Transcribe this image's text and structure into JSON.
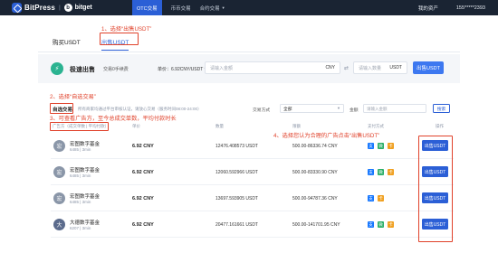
{
  "nav": {
    "brand": "BitPress",
    "partner": "bitget",
    "links": [
      {
        "label": "OTC交易",
        "active": true
      },
      {
        "label": "币币交易",
        "active": false
      },
      {
        "label": "合约交易",
        "active": false
      }
    ],
    "my_assets": "我的资产",
    "user": "155*****2393"
  },
  "tabs": {
    "buy": "购买USDT",
    "sell": "出售USDT"
  },
  "annotations": {
    "step1": "1、选择“出售USDT”",
    "step2": "2、选择“自选交易”",
    "step3": "3、可查看广告方，至今总成交单数，平均付款时长",
    "step4": "4、选择您认为合理的广告点击“出售USDT”"
  },
  "quick": {
    "title": "极速出售",
    "subtitle": "交易0手续费",
    "price_label": "单价：",
    "price_value": "6.92CNY/USDT",
    "price_caret": "▾",
    "amount_placeholder": "请输入金额",
    "amount_unit": "CNY",
    "swap": "⇄",
    "qty_placeholder": "请输入数量",
    "qty_unit": "USDT",
    "button": "出售USDT"
  },
  "filter": {
    "tab": "自选交易",
    "note": "所有商家均通过平台审核认证，请放心交易（服务时间08:00-24:00）",
    "payment_label": "交易方式",
    "payment_value": "全部",
    "amount_label": "金额",
    "amount_placeholder": "请输入金额",
    "search": "搜索"
  },
  "table": {
    "headers": {
      "advertiser": "广告方（成交单数 | 平均付款）",
      "price": "单价",
      "qty": "数量",
      "limit": "限额",
      "payment": "支付方式",
      "action": "操作"
    },
    "action_label": "出售USDT",
    "rows": [
      {
        "initial": "宏",
        "color": "#8a96a8",
        "name": "宏图数字基金",
        "stats": "6485 | 3min",
        "price": "6.92 CNY",
        "qty": "12476.408573 USDT",
        "limit": "500.00-86336.74 CNY",
        "pays": [
          "ali",
          "wx",
          "bank"
        ]
      },
      {
        "initial": "宏",
        "color": "#8a96a8",
        "name": "宏图数字基金",
        "stats": "6485 | 3min",
        "price": "6.92 CNY",
        "qty": "12060.592966 USDT",
        "limit": "500.00-83330.90 CNY",
        "pays": [
          "ali",
          "wx",
          "bank"
        ]
      },
      {
        "initial": "宏",
        "color": "#8a96a8",
        "name": "宏图数字基金",
        "stats": "6485 | 3min",
        "price": "6.92 CNY",
        "qty": "13697.593905 USDT",
        "limit": "500.00-94787.36 CNY",
        "pays": [
          "ali",
          "bank"
        ]
      },
      {
        "initial": "大",
        "color": "#5b6b8c",
        "name": "大德数字基金",
        "stats": "6207 | 3min",
        "price": "6.92 CNY",
        "qty": "20477.161661 USDT",
        "limit": "500.00-141701.95 CNY",
        "pays": [
          "ali",
          "wx",
          "bank"
        ]
      }
    ]
  }
}
